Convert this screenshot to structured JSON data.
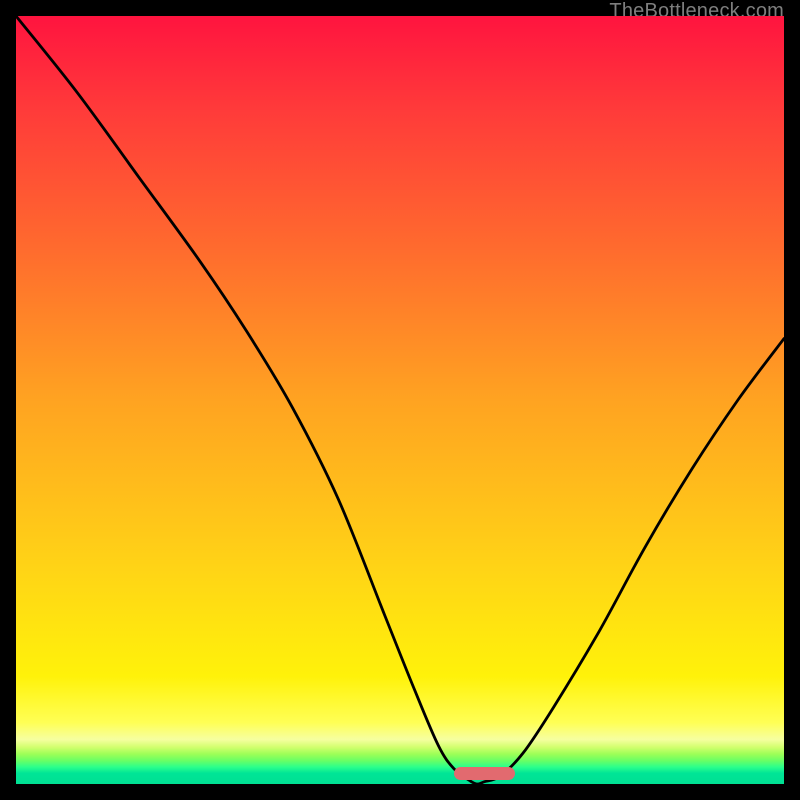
{
  "watermark": {
    "text": "TheBottleneck.com"
  },
  "chart_data": {
    "type": "line",
    "title": "",
    "xlabel": "",
    "ylabel": "",
    "xlim": [
      0,
      100
    ],
    "ylim": [
      0,
      100
    ],
    "grid": false,
    "legend": false,
    "series": [
      {
        "name": "bottleneck-curve",
        "x": [
          0,
          8,
          16,
          24,
          30,
          36,
          42,
          48,
          52,
          55,
          57,
          59,
          60,
          61,
          63,
          66,
          70,
          76,
          82,
          88,
          94,
          100
        ],
        "values": [
          100,
          90,
          79,
          68,
          59,
          49,
          37,
          22,
          12,
          5,
          2,
          0.5,
          0,
          0.3,
          1,
          4,
          10,
          20,
          31,
          41,
          50,
          58
        ]
      }
    ],
    "marker": {
      "name": "optimal-range",
      "x_start": 57,
      "x_end": 65,
      "y": 0,
      "color": "#e26a6f"
    },
    "background_gradient": {
      "direction": "vertical",
      "stops": [
        {
          "pos": 0.0,
          "color": "#ff143f"
        },
        {
          "pos": 0.5,
          "color": "#ffa321"
        },
        {
          "pos": 0.86,
          "color": "#fff20a"
        },
        {
          "pos": 0.95,
          "color": "#d2ff6e"
        },
        {
          "pos": 1.0,
          "color": "#00e093"
        }
      ]
    }
  }
}
